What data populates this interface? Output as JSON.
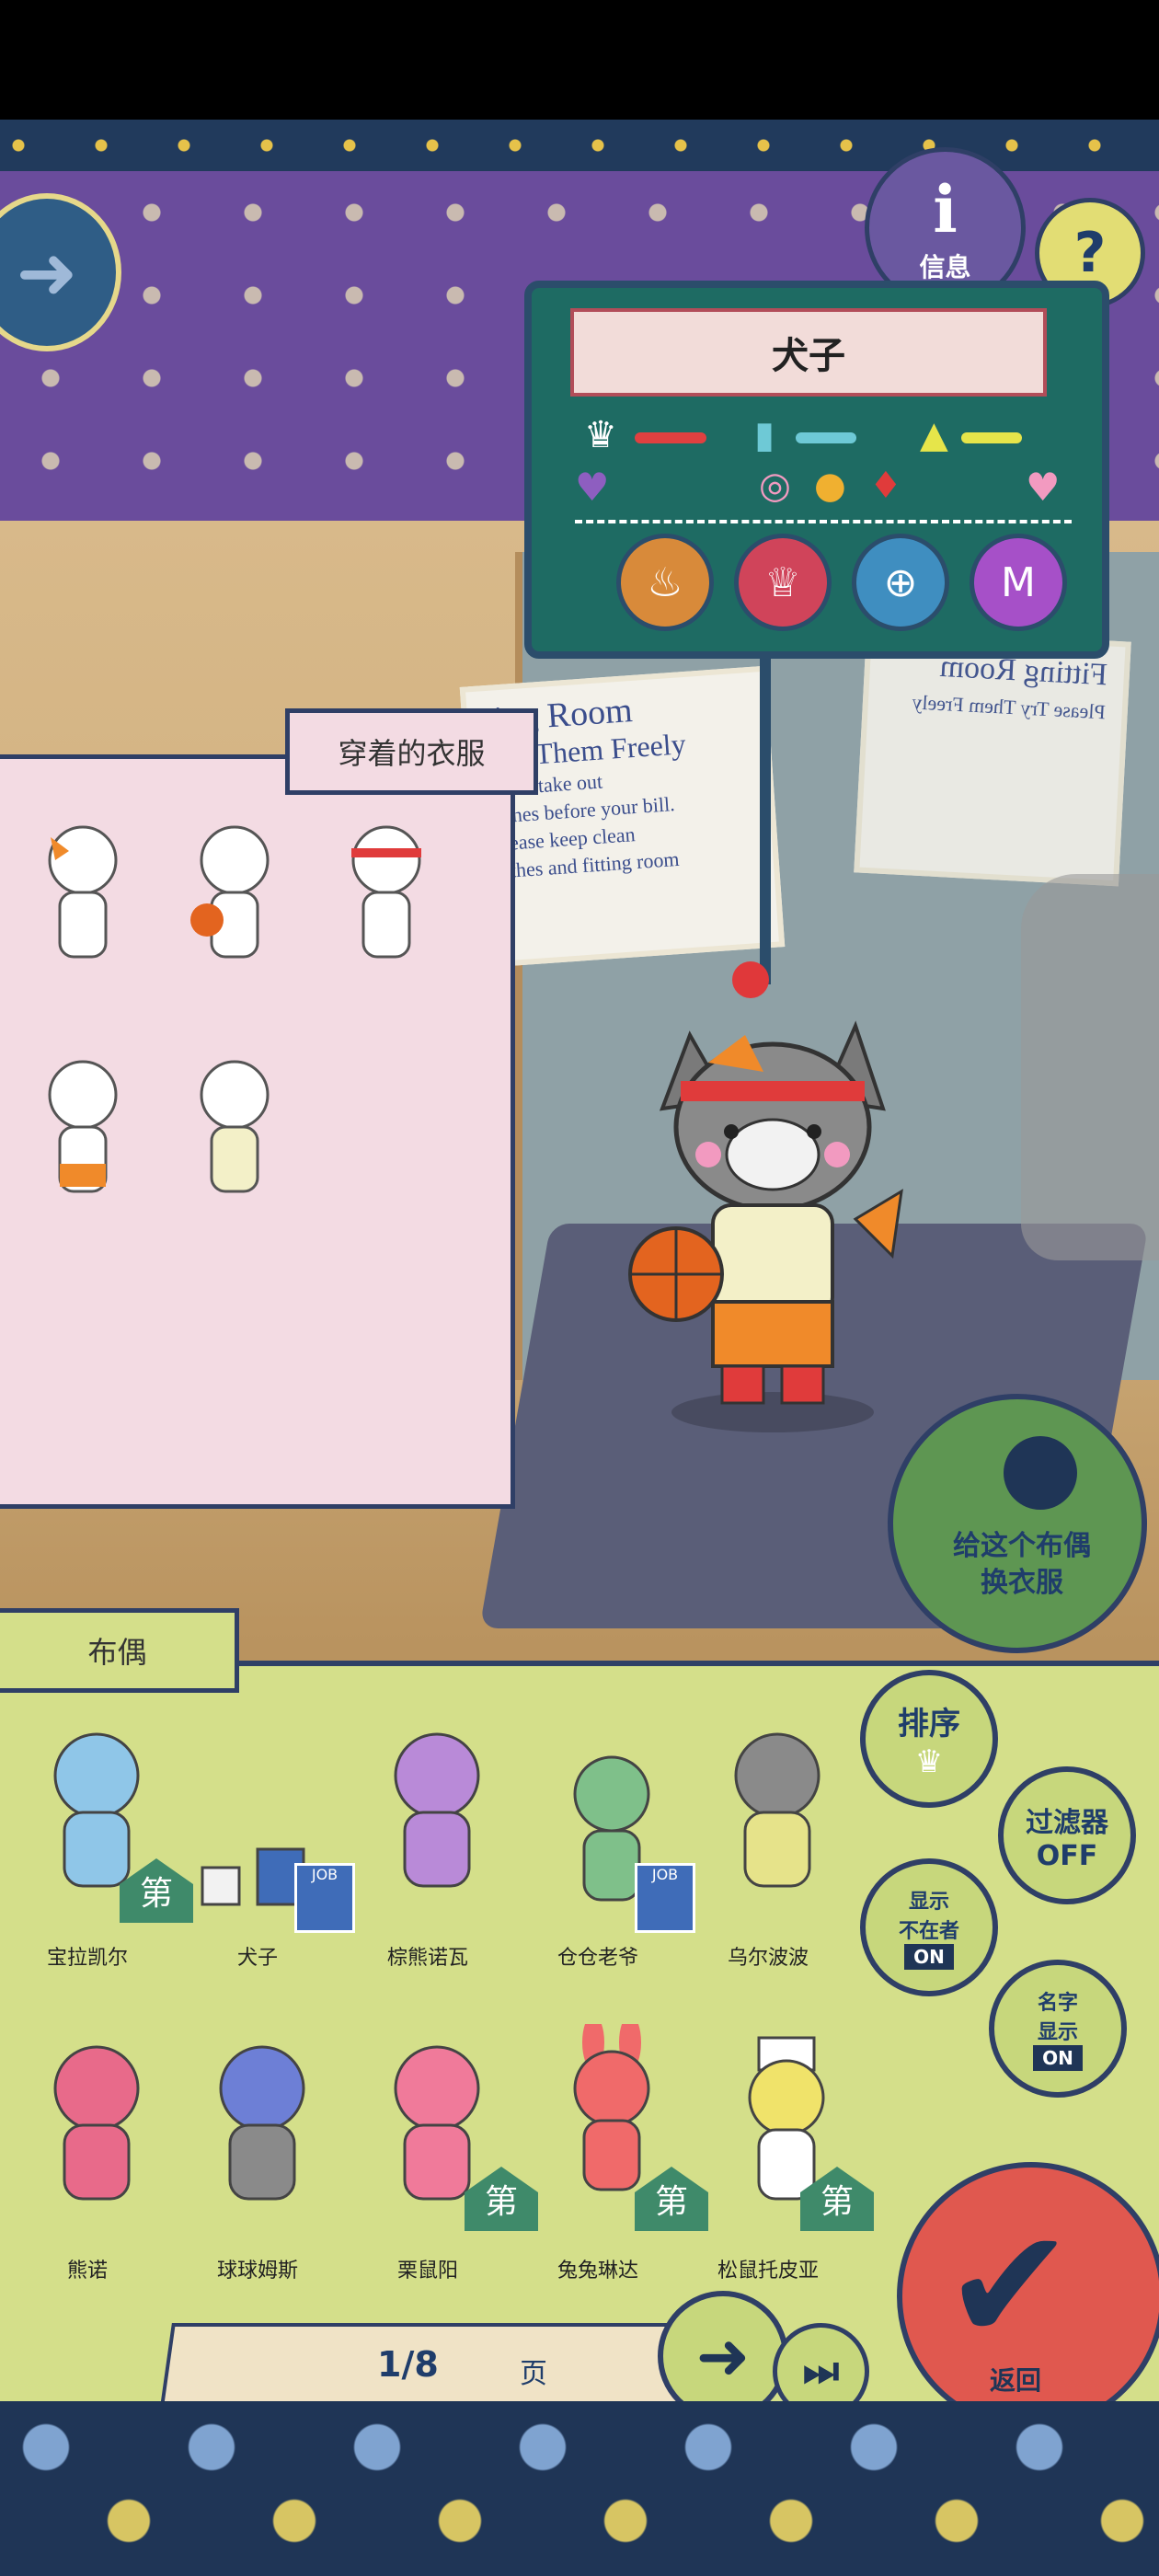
{
  "character": {
    "name": "犬子",
    "info_label": "信息",
    "help_symbol": "?",
    "colors": {
      "hunger": "#e04040",
      "clean": "#6ec9d6",
      "energy": "#e6e54a"
    },
    "stats": [
      {
        "icon": "chef-hat-icon",
        "level": 0.65
      },
      {
        "icon": "soap-icon",
        "level": 0.55
      },
      {
        "icon": "shoe-icon",
        "level": 0.55
      }
    ],
    "action_icons": [
      {
        "name": "table-icon",
        "glyph": "♨"
      },
      {
        "name": "chef-hat-icon",
        "glyph": "♕"
      },
      {
        "name": "plate-icon",
        "glyph": "⊕"
      },
      {
        "name": "money-icon",
        "glyph": "M"
      }
    ]
  },
  "scene": {
    "sign_left": [
      "ting Room",
      "Try Them Freely",
      "Don't take out",
      "lothes before your bill.",
      "Please keep clean",
      "lothes and fitting room"
    ],
    "sign_right": [
      "Fitting Room",
      "Please Try Them Freely"
    ]
  },
  "clothes": {
    "title": "穿着的衣服",
    "count": 5
  },
  "dress_button": {
    "line1": "给这个布偶",
    "line2": "换衣服"
  },
  "dolls_panel": {
    "title": "布偶",
    "dolls": [
      {
        "name": "宝拉凯尔",
        "color": "#8fc6e8"
      },
      {
        "name": "犬子",
        "color": "#f2f2f2"
      },
      {
        "name": "棕熊诺瓦",
        "color": "#b98ad8"
      },
      {
        "name": "仓仓老爷",
        "color": "#7fc08a"
      },
      {
        "name": "乌尔波波",
        "color": "#8a8a8a"
      },
      {
        "name": "熊诺",
        "color": "#e86a8a"
      },
      {
        "name": "球球姆斯",
        "color": "#6d7fd6"
      },
      {
        "name": "栗鼠阳",
        "color": "#f07a9a"
      },
      {
        "name": "兔兔琳达",
        "color": "#f06a6a"
      },
      {
        "name": "松鼠托皮亚",
        "color": "#f0e36a"
      }
    ],
    "badges": {
      "first": "第",
      "job": "JOB"
    }
  },
  "side_buttons": {
    "sort": "排序",
    "filter_line1": "过滤器",
    "filter_line2": "OFF",
    "show_absent_line1": "显示",
    "show_absent_line2": "不在者",
    "show_absent_state": "ON",
    "show_name_line1": "名字",
    "show_name_line2": "显示",
    "show_name_state": "ON"
  },
  "pagination": {
    "current": "1/8",
    "unit": "页"
  },
  "confirm_label": "返回"
}
